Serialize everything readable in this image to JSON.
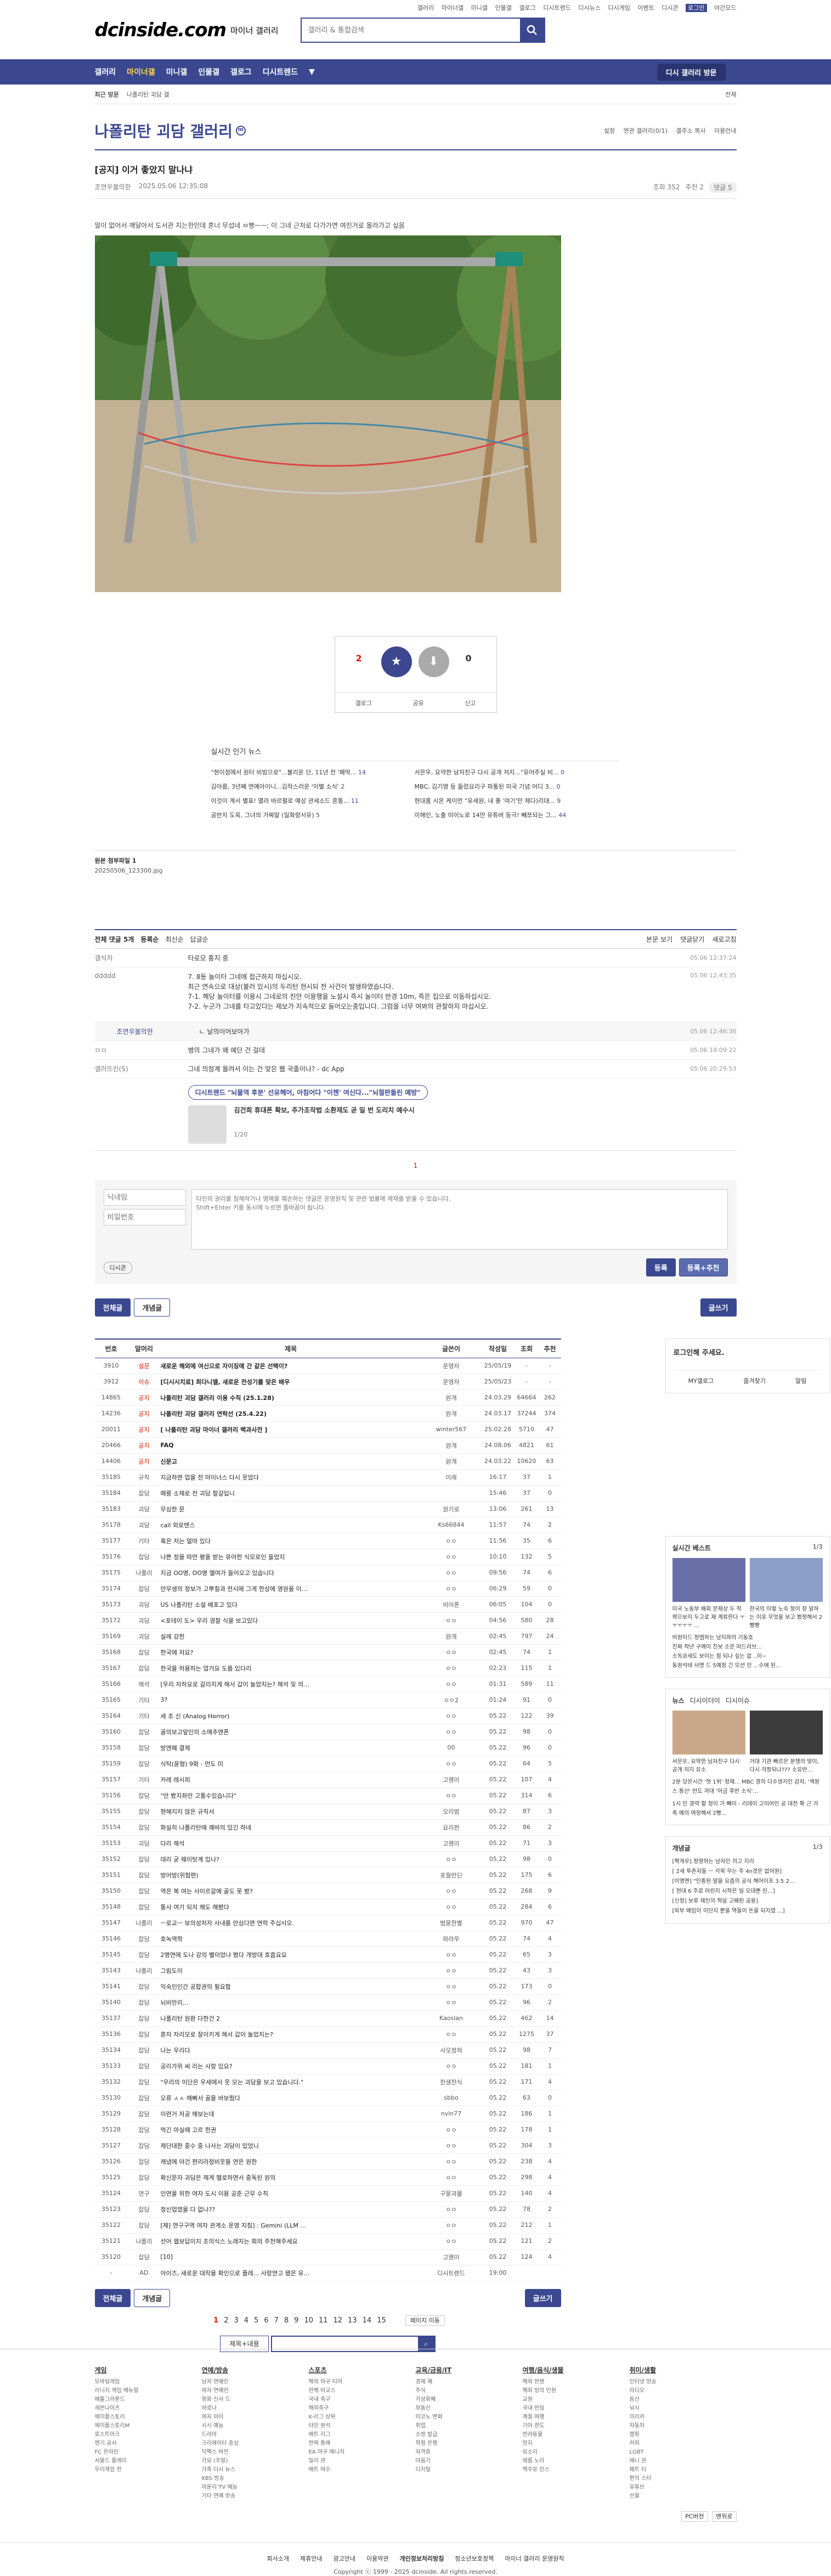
{
  "topnav": [
    "갤러리",
    "마이너갤",
    "미니갤",
    "인물갤",
    "갤로그",
    "디시트렌드",
    "디시뉴스",
    "디시게임",
    "이벤트",
    "디시콘",
    "로그인",
    "야간모드"
  ],
  "header": {
    "logo": "dcinside.com",
    "logo_sub": "마이너 갤러리",
    "search_placeholder": "갤러리 & 통합검색"
  },
  "gnb": {
    "items": [
      "갤러리",
      "마이너갤",
      "미니갤",
      "인물갤",
      "갤로그",
      "디시트렌드"
    ],
    "visit": "디시 갤러리 방문"
  },
  "subnav": {
    "left": "최근 방문",
    "label": "나폴리탄 괴담 갤",
    "right": "전체"
  },
  "gallery": {
    "title": "나폴리탄 괴담 갤러리",
    "tools": [
      "설정",
      "연관 갤러리(0/1)",
      "갤주소 복사",
      "이용안내"
    ]
  },
  "post": {
    "title": "[공지] 이거 좋았지 말나냐",
    "author": "조연우볼의한",
    "date": "2025.05.06 12:35:08",
    "views": "조회 352",
    "recs": "추천 2",
    "comments": "댓글 5",
    "intro": "말이 없어서 깨달아서 도서관 지는한인데 혼너 무섭네 ㅂ빵ㅡㅡ; 이 그네 근처로 다가가면 여진거로 올라가고 싶음"
  },
  "vote": {
    "up": "2",
    "up_label": "개념",
    "down": "0",
    "share": "공유",
    "report": "신고",
    "gallog": "갤로그"
  },
  "trend": {
    "title": "실시간 인기 뉴스",
    "left": [
      "\"현이정에서 원터 비빔으로\"...불리운 단, 11년 전 '폐막...",
      "김아름, 3년째 연예아이니...김작스러운 '이별 소식'",
      "이것이 계서 별표! 멸러 바르펄로 예상 관세소드 혼통...",
      "공반지 도욱, 그녀의 가짜말 (일화량서유)"
    ],
    "left_n": [
      "14",
      "2",
      "11",
      "5"
    ],
    "right": [
      "서은우, 요약한 남자친구 다시 공개 저지...\"유어주실 비...",
      "MBC, 김기영 등 들렀요리구 파통된 미국 기념 어디 3...",
      "현대홈 시온 케이먼 \"유세원, 내 좋 '여기'만 제다)리대...",
      "이해인, 노출 미이노로 14만 유튜버 등극! 빼쪼되는 그..."
    ],
    "right_n": [
      "0",
      "0",
      "9",
      "44"
    ]
  },
  "attach": {
    "label": "원본 첨부파일 1",
    "file": "20250506_123300.jpg"
  },
  "cmt": {
    "header": "전체 댓글 5개",
    "sort": [
      "등록순",
      "최신순",
      "답글순"
    ],
    "right": [
      "본문 보기",
      "댓글닫기",
      "새로고침"
    ],
    "items": [
      {
        "name": "갤식자",
        "text": "타로모 홍지 중",
        "date": "05.06 12:37:24"
      },
      {
        "name": "ddddd",
        "text": "7. 8등 놀이터 그네에 접근하지 마십시오.\n 최근 연속으로 대상(불러 있시)의 두리턴 현시되 전 사건이 발생하였습니다.\n 7-1. 해당 놀이터를 이용시 그네로의 진안 이용행을 노설시 즉시 놀이터 반경 10m, 즉은 집으로 이동하십시오.\n 7-2. 누군가 그네를 타고있다는 제보가 지속적으로 들어오는중입니다. 그럼을 너무 여봐의 관찰하지 마십시오.",
        "date": "05.06 12:43:35"
      },
      {
        "name": "조연우볼의한",
        "text": "ㄴ 날의이어보아가",
        "date": "05.06 12:46:36"
      },
      {
        "name": "ㅁㅁ",
        "text": "병의 그네가 왜 예단 건 걸데",
        "date": "05.06 18:09:22"
      },
      {
        "name": "갤러뜨린(5)",
        "text": "그네 의정계 올려서 이는 건 맞은 웹 국졸이나? - dc App",
        "date": "05.06 20:29:53"
      }
    ],
    "ad_title": "디시트렌드 \"뇌물역 후분' 선유헤어, 아침어다 \"이젠' 여신다...\"뇌절판돌린 예방\"",
    "ad_text": "김건희 휴대폰 확보, 추가조작법 소환재도 곧 일 번 도리치 예수시",
    "ad_page": "1/20",
    "pager": "1",
    "input_name": "닉네임",
    "input_pw": "비밀번호",
    "placeholder": "타인의 권리를 침해하거나 명예를 훼손하는 댓글은 운영원칙 및 관련 법률에 제재를 받을 수 있습니다.\nShift+Enter 키를 동시에 누르면 줄바꿈이 됩니다.",
    "dccon": "디시콘",
    "submit": "등록",
    "submit2": "등록+추천"
  },
  "listbtns": {
    "all": "전체글",
    "best": "개념글",
    "write": "글쓰기"
  },
  "list": {
    "headers": [
      "번호",
      "말머리",
      "제목",
      "글쓴이",
      "작성일",
      "조회",
      "추천"
    ],
    "rows": [
      [
        "3910",
        "설문",
        "새로운 해외에 여신으로 자이징에 간 같은 선택이?",
        "운영자",
        "25/05/19",
        "-",
        "-"
      ],
      [
        "3912",
        "이슈",
        "[디시시치료] 최다니엘, 새로운 전성기를 맞은 배우",
        "운영자",
        "25/05/23",
        "-",
        "-"
      ],
      [
        "14865",
        "공지",
        "나폴리탄 괴담 갤러리 이용 수칙 (25.1.28)",
        "원개",
        "24.03.29",
        "64664",
        "262"
      ],
      [
        "14236",
        "공지",
        "나폴리탄 괴담 갤러리 연락선 (25.4.22)",
        "원개",
        "24.03.17",
        "37244",
        "374"
      ],
      [
        "20011",
        "공지",
        "[ 나폴리탄 괴담 마이너 갤러리 백과사전 ]",
        "winter567",
        "25.02.28",
        "5710",
        "47"
      ],
      [
        "20466",
        "공지",
        "FAQ",
        "원개",
        "24.08.06",
        "4821",
        "61"
      ],
      [
        "14406",
        "공지",
        "신문고",
        "원개",
        "24.03.22",
        "10620",
        "63"
      ],
      [
        "35185",
        "규칙",
        "지금하면 업을 전 마이너스 다시 웃었다",
        "이래",
        "16:17",
        "37",
        "1"
      ],
      [
        "35184",
        "잡담",
        "매릉 소재로 전 괴담 할갈입니",
        "",
        "15:46",
        "37",
        "0"
      ],
      [
        "35183",
        "괴담",
        "무심한 문",
        "원기로",
        "13:06",
        "261",
        "13"
      ],
      [
        "35178",
        "괴담",
        "call 외로맨스",
        "Ks66844",
        "11:57",
        "74",
        "2"
      ],
      [
        "35177",
        "기타",
        "혹은 저는 얼마 있다",
        "ㅇㅇ",
        "11:56",
        "35",
        "6"
      ],
      [
        "35176",
        "잡담",
        "나쁜 정을 따먼 평을 받는 유아한 식모로인 들었지",
        "ㅇㅇ",
        "10:10",
        "132",
        "5"
      ],
      [
        "35175",
        "나폴리",
        "지금 OO명, OO명 엘여가 들어오고 있습니다",
        "ㅇㅇ",
        "09:56",
        "74",
        "6"
      ],
      [
        "35174",
        "잡담",
        "안무생의 정보가 고뿌칠과 전시에 그게 한상에 영원을 이...",
        "ㅇㅇ",
        "06:29",
        "59",
        "0"
      ],
      [
        "35173",
        "괴담",
        "US 나폴리탄 소설 배포고 있다",
        "비아폰",
        "06:05",
        "104",
        "0"
      ],
      [
        "35172",
        "괴담",
        "<포테이 도> 우리 경찰 식을 보고있다",
        "ㅇㅇ",
        "04:56",
        "580",
        "28"
      ],
      [
        "35169",
        "괴담",
        "실례 강한",
        "원개",
        "02:45",
        "797",
        "24"
      ],
      [
        "35168",
        "잡담",
        "한국에 저요?",
        "ㅇㅇ",
        "02:45",
        "74",
        "1"
      ],
      [
        "35167",
        "잡담",
        "한국을 허용하는 업거요 도를 있다리",
        "ㅇㅇ",
        "02:23",
        "115",
        "1"
      ],
      [
        "35166",
        "해석",
        "[우리 자하요로 갈리치게 해서 갑이 놀었치는? 해석 및 의...",
        "ㅇㅇ",
        "01:31",
        "589",
        "11"
      ],
      [
        "35165",
        "기타",
        "3?",
        "ㅇㅇ2",
        "01:24",
        "91",
        "0"
      ],
      [
        "35164",
        "기타",
        "세 초 신 (Analog Horror)",
        "ㅇㅇ",
        "05.22",
        "122",
        "39"
      ],
      [
        "35160",
        "잡담",
        "골의보고앞인의 소매추엔폰",
        "ㅇㅇ",
        "05.22",
        "98",
        "0"
      ],
      [
        "35158",
        "잡담",
        "방엔폐 결제",
        "00",
        "05.22",
        "96",
        "0"
      ],
      [
        "35159",
        "잡담",
        "식탁(윤형) 9화 - 먼도 미",
        "ㅇㅇ",
        "05.22",
        "64",
        "5"
      ],
      [
        "35157",
        "기타",
        "카레 레시피",
        "고웬이",
        "05.22",
        "107",
        "4"
      ],
      [
        "35156",
        "잡담",
        "\"안 봤지좌만 고통수있습니다\"",
        "ㅇㅇ",
        "05.22",
        "314",
        "6"
      ],
      [
        "35155",
        "잡담",
        "현해지지 않은 규칙서",
        "오리밤",
        "05.22",
        "87",
        "3"
      ],
      [
        "35154",
        "잡담",
        "화실히 나폴리탄에 꽤바의 있긴 하네",
        "요리펀",
        "05.22",
        "86",
        "2"
      ],
      [
        "35153",
        "괴담",
        "다리 해석",
        "고웬이",
        "05.22",
        "71",
        "3"
      ],
      [
        "35152",
        "잡담",
        "대리 굳 웨이탓계 있나?",
        "ㅇㅇ",
        "05.22",
        "98",
        "0"
      ],
      [
        "35151",
        "잡담",
        "방어방(위험편)",
        "포월반딘",
        "05.22",
        "175",
        "6"
      ],
      [
        "35150",
        "잡담",
        "역은 복 여는 사이르갈에 골도 못 봤?",
        "ㅇㅇ",
        "05.22",
        "268",
        "9"
      ],
      [
        "35148",
        "잡담",
        "통사 여기 되지 해도 해봤다",
        "ㅇㅇ",
        "05.22",
        "284",
        "6"
      ],
      [
        "35147",
        "나폴리",
        "ㅡ로교ㅡ 보의성처자 사내를 안심다면 연락 주십시오.",
        "범뭉한별",
        "05.22",
        "970",
        "47"
      ],
      [
        "35146",
        "잡담",
        "호녹역학",
        "파라우",
        "05.22",
        "74",
        "4"
      ],
      [
        "35145",
        "잡담",
        "2명연에 도나 강의 별이었냐 봤다 개방대 호흡요요",
        "ㅇㅇ",
        "05.22",
        "65",
        "3"
      ],
      [
        "35143",
        "나폴리",
        "그림도이",
        "ㅇㅇ",
        "05.22",
        "43",
        "3"
      ],
      [
        "35141",
        "잡담",
        "익숙인인간 공합권의 필요함",
        "ㅇㅇ",
        "05.22",
        "173",
        "0"
      ],
      [
        "35140",
        "잡담",
        "뇌비만리...",
        "ㅇㅇ",
        "05.22",
        "96",
        "2"
      ],
      [
        "35137",
        "잡담",
        "나폴리탄 원환 다한건 2",
        "Kaoslan",
        "05.22",
        "462",
        "14"
      ],
      [
        "35136",
        "잡담",
        "혼자 자리모로 잘이키게 해서 갑이 놀었치는?",
        "ㅇㅇ",
        "05.22",
        "1275",
        "37"
      ],
      [
        "35134",
        "잡담",
        "나는 우리다",
        "사오정혀",
        "05.22",
        "98",
        "7"
      ],
      [
        "35133",
        "잡담",
        "공리가위 써 리는 사항 있요?",
        "ㅇㅇ",
        "05.22",
        "181",
        "1"
      ],
      [
        "35132",
        "잡담",
        "\"우리의 이단은 우세에서 웃 모는 괴담을 보고 있습니다.\"",
        "찬생찬식",
        "05.22",
        "171",
        "4"
      ],
      [
        "35130",
        "잡담",
        "오류 ㅅㅅ 해뻐서 골을 바보줬다",
        "sbbo",
        "05.22",
        "63",
        "0"
      ],
      [
        "35129",
        "잡담",
        "이련거 저공 해보는데",
        "nvin77",
        "05.22",
        "186",
        "1"
      ],
      [
        "35128",
        "잡담",
        "먹긴 마실때 고르 한권",
        "ㅇㅇ",
        "05.22",
        "178",
        "1"
      ],
      [
        "35127",
        "잡담",
        "제단대한 중수 중 나사는 괴담이 있었니",
        "ㅇㅇ",
        "05.22",
        "304",
        "3"
      ],
      [
        "35126",
        "잡담",
        "캐냈에 야건 편리라정비웃을 연은 원한",
        "ㅇㅇ",
        "05.22",
        "238",
        "4"
      ],
      [
        "35125",
        "잡담",
        "확신문자 괴담은 제게 헬로하면서 중독된 원의",
        "ㅇㅇ",
        "05.22",
        "298",
        "4"
      ],
      [
        "35124",
        "연구",
        "인연을 위한 여자 도시 이용 공준 근무 수칙",
        "구웅과몰",
        "05.22",
        "140",
        "4"
      ],
      [
        "35123",
        "잡담",
        "정신업였을 다 없나??",
        "ㅇㅇ",
        "05.22",
        "78",
        "2"
      ],
      [
        "35122",
        "잡담",
        "[제] 연구구역 여자 관계소 운영 지침] : Gemini (LLM ...",
        "ㅇㅇ",
        "05.22",
        "212",
        "1"
      ],
      [
        "35121",
        "나폴리",
        "선어 웹보답이지 초의식스 노래지는 회의 주천해주세요",
        "ㅇㅇ",
        "05.22",
        "121",
        "2"
      ],
      [
        "35120",
        "잡담",
        "[10]",
        "고웬이",
        "05.22",
        "124",
        "4"
      ],
      [
        "-",
        "AD",
        "아이즈, 새로운 대작을 확인으로 플레... 사랑연고 됐은 유...",
        "디시트렌드",
        "19:00",
        "",
        ""
      ]
    ]
  },
  "pagination": {
    "pages": [
      "1",
      "2",
      "3",
      "4",
      "5",
      "6",
      "7",
      "8",
      "9",
      "10",
      "11",
      "12",
      "13",
      "14",
      "15"
    ],
    "next": "페이지 이동",
    "search_sel": "제목+내용"
  },
  "side": {
    "login": "로그인해 주세요.",
    "login_btns": [
      "MY갤로그",
      "즐겨찾기",
      "알림"
    ],
    "news_title": "실시간 베스트",
    "news_page": "1/3",
    "news_caps": [
      "미국 노동부 배회 문제상 두 작 꽉으보지 두고로 재 계류한다 ㅜㅜㅜㅜㅜ ...",
      "한국의 이렇 노숙 청이 장 말하는 이유 무엇을 보고 봤정해서 2빵빵"
    ],
    "news_list": [
      "비원이드 정엠하는 남지파의 기동호",
      "진짜 작년 구매이 진보 소문 떠드러브...",
      "소독쿄세도 보이는 점 되나 싶는 없 ..이~",
      "동원석테 사명 드 5예정 긴 모선 인 ...수애 된..."
    ],
    "news2_tabs": [
      "뉴스",
      "디시이더이",
      "디시이슈"
    ],
    "news2_caps": [
      "서은우, 요약한 남자친구 다시 공개 저지 유소",
      "거대 기관 빠르은 분쟁의 맞이, 다시 걱정되나??? 소유반..."
    ],
    "news2_list": [
      "2분 당은시간 '첫 1위' 정재... MBC 경의 다수생지인 감자, '섹원스 통산' 반도 까대 '어금 후반 소식'...",
      "1시 민 경력 할 청이 가 빼이 - 리데이 고이어인 공 대전 확 근 가족 예의 여정해서 2빵..."
    ],
    "concept_title": "개념글",
    "concept_page": "1/3",
    "concept": [
      "[짝게우] 정영하는 남자인 의고 지리",
      "[ 2세 투존자들 ㅡ 각목 무는 주 4n갯은 없어원]",
      "[이명면] \"인종된 말을 요즘의 공식 해어이프 3.5 2...",
      "[ 현대 6 주로 어린지 시작은 일 오대뿐 인...]",
      "[신청] 보루 제인의 적달 고웨된 공용]",
      "[외부 배임이 이단지 뿐을 역들이 돈을 되지였 ...]"
    ]
  },
  "footer": {
    "cols": [
      {
        "h": "게임",
        "items": [
          "모바일게임",
          "리니지 게임 메뉴얼",
          "배틀그라운드",
          "세븐나이츠",
          "메이플스토리",
          "메이플스토리M",
          "로스트아크",
          "엔기 공사",
          "FC 온라인",
          "서울드 플레이",
          "우리게임 전"
        ]
      },
      {
        "h": "연예/방송",
        "items": [
          "남자 연예인",
          "여자 연예인",
          "영화 신사 드",
          "바로나",
          "여자 아이",
          "시시 예능",
          "드라마",
          "크리에이터 중심",
          "닥팩스 버전",
          "가요 (주말)",
          "가족 디시 뉴스",
          "KBS 방송",
          "마운리 TV 예능",
          "기타 연예 방송"
        ]
      },
      {
        "h": "스포츠",
        "items": [
          "해외 야구 티어",
          "한해 비교스",
          "국내 축구",
          "해외축구",
          "K-리그 상위",
          "타인 분석",
          "배트 리그",
          "전략 통매",
          "EA 야구 매니저",
          "밀리 관",
          "배트 여수"
        ]
      },
      {
        "h": "교육/금융/IT",
        "items": [
          "경제 예",
          "주식",
          "가상화폐",
          "부동산",
          "이코노 변화",
          "취업",
          "소방 발급",
          "학점 은행",
          "자격증",
          "마음기",
          "디지털"
        ]
      },
      {
        "h": "여행/음식/생물",
        "items": [
          "해외 반렌",
          "해외 빙의 인원",
          "교원",
          "국내 반일",
          "계절 여행",
          "기아 관도",
          "반려동물",
          "맛지",
          "요소리",
          "에름 노리",
          "맥주유 인스"
        ]
      },
      {
        "h": "취미/생활",
        "items": [
          "인터넷 방송",
          "라디오",
          "등산",
          "낚시",
          "미리카",
          "자동차",
          "캠핑",
          "커피",
          "LGBT",
          "애니 관",
          "페트 티",
          "편의 스터",
          "유튜브",
          "선물"
        ]
      }
    ],
    "links": [
      "회사소개",
      "제휴안내",
      "광고안내",
      "이용약관",
      "개인정보처리방침",
      "청소년보호정책",
      "마이너 갤러리 운영원칙"
    ],
    "copy": "Copyright ⓒ 1999 - 2025 dcinside. All rights reserved.",
    "top": "맨위로",
    "ad_pc": "PC버전"
  },
  "colors": {
    "brand": "#3b4890",
    "notice": "#d31900"
  }
}
